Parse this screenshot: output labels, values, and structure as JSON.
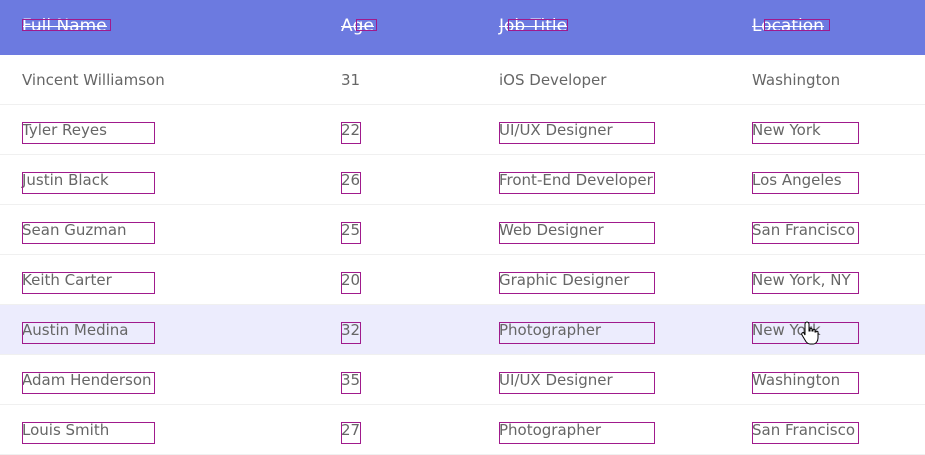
{
  "table": {
    "headers": [
      "Full Name",
      "Age",
      "Job Title",
      "Location"
    ],
    "rows": [
      [
        "Vincent Williamson",
        "31",
        "iOS Developer",
        "Washington"
      ],
      [
        "Tyler Reyes",
        "22",
        "UI/UX Designer",
        "New York"
      ],
      [
        "Justin Black",
        "26",
        "Front-End Developer",
        "Los Angeles"
      ],
      [
        "Sean Guzman",
        "25",
        "Web Designer",
        "San Francisco"
      ],
      [
        "Keith Carter",
        "20",
        "Graphic Designer",
        "New York, NY"
      ],
      [
        "Austin Medina",
        "32",
        "Photographer",
        "New York"
      ],
      [
        "Adam Henderson",
        "35",
        "UI/UX Designer",
        "Washington"
      ],
      [
        "Louis Smith",
        "27",
        "Photographer",
        "San Francisco"
      ]
    ]
  },
  "colors": {
    "header_bg": "#6c7ae0",
    "hover_row_bg": "#ececfd",
    "annotation_box": "#a01a8c"
  },
  "icons": {
    "cursor": "hand-pointer-icon"
  }
}
